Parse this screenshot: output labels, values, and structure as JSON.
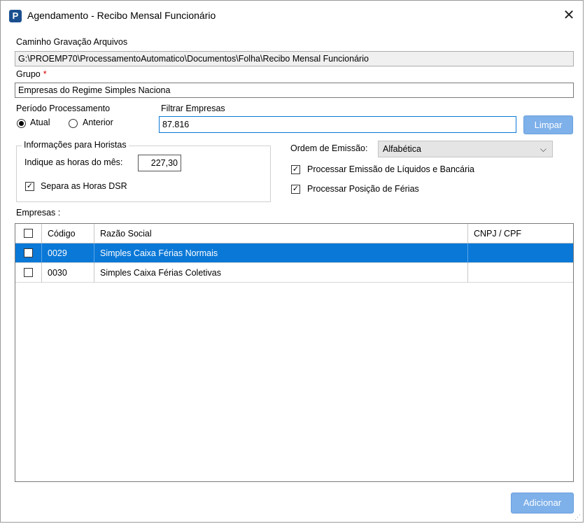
{
  "window": {
    "title": "Agendamento - Recibo Mensal Funcionário",
    "app_icon": "P",
    "close_glyph": "✕"
  },
  "caminho": {
    "label": "Caminho Gravação Arquivos",
    "value": "G:\\PROEMP70\\ProcessamentoAutomatico\\Documentos\\Folha\\Recibo Mensal Funcionário"
  },
  "grupo": {
    "label": "Grupo",
    "required_mark": "*",
    "value": "Empresas do Regime Simples Naciona"
  },
  "periodo": {
    "label": "Período Processamento",
    "options": [
      "Atual",
      "Anterior"
    ],
    "selected": "Atual"
  },
  "filtro": {
    "label": "Filtrar Empresas",
    "value": "87.816",
    "clear_label": "Limpar"
  },
  "horistas": {
    "legend": "Informações para Horistas",
    "horas_label": "Indique as horas do mês:",
    "horas_value": "227,30",
    "dsr_label": "Separa as Horas DSR",
    "dsr_checked": true
  },
  "ordem": {
    "label": "Ordem de Emissão:",
    "value": "Alfabética"
  },
  "opcoes": {
    "liquidos_label": "Processar Emissão de Líquidos e Bancária",
    "liquidos_checked": true,
    "ferias_label": "Processar Posição de Férias",
    "ferias_checked": true
  },
  "empresas": {
    "label": "Empresas :",
    "columns": [
      "Código",
      "Razão Social",
      "CNPJ / CPF"
    ],
    "rows": [
      {
        "codigo": "0029",
        "razao": "Simples Caixa Férias Normais",
        "cnpj": "",
        "checked": false,
        "selected": true
      },
      {
        "codigo": "0030",
        "razao": "Simples Caixa Férias Coletivas",
        "cnpj": "",
        "checked": false,
        "selected": false
      }
    ]
  },
  "footer": {
    "add_label": "Adicionar"
  },
  "colors": {
    "selection": "#0a78d7",
    "button": "#7eb0ea",
    "required": "#d10000"
  },
  "icons": {
    "check": "✓",
    "chevron": "⌵"
  }
}
